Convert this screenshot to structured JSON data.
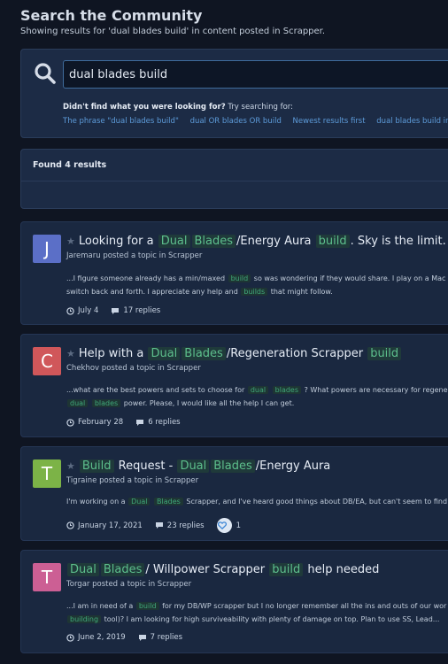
{
  "header": {
    "title": "Search the Community",
    "subtitle": "Showing results for 'dual blades build' in content posted in Scrapper."
  },
  "search": {
    "value": "dual blades build",
    "not_found_bold": "Didn't find what you were looking for?",
    "not_found_rest": " Try searching for:",
    "suggestions": [
      "The phrase \"dual blades build\"",
      "dual OR blades OR build",
      "Newest results first",
      "dual blades build in co"
    ]
  },
  "results_bar": {
    "count_label": "Found 4 results"
  },
  "results": [
    {
      "avatar_letter": "J",
      "avatar_color": "#5b6fc7",
      "title_pre": "Looking for a",
      "title_hl1": "Dual",
      "title_hl2": "Blades",
      "title_mid": "/Energy Aura",
      "title_hl3": "build",
      "title_post": ". Sky is the limit.",
      "meta": "Jaremaru posted a topic in Scrapper",
      "snippet_line1_a": "...I figure someone already has a min/maxed",
      "snippet_line1_hl": "build",
      "snippet_line1_b": "so was wondering if they would share. I play on a Mac",
      "snippet_line2_a": "switch back and forth. I appreciate any help and",
      "snippet_line2_hl": "builds",
      "snippet_line2_b": "that might follow.",
      "date": "July 4",
      "replies": "17 replies"
    },
    {
      "avatar_letter": "C",
      "avatar_color": "#d0575a",
      "title_pre": "Help with a",
      "title_hl1": "Dual",
      "title_hl2": "Blades",
      "title_mid": "/Regeneration Scrapper",
      "title_hl3": "build",
      "meta": "Chekhov posted a topic in Scrapper",
      "snippet_line1_a": "...what are the best powers and sets to choose for",
      "snippet_line1_hl": "dual",
      "snippet_line1_hl2": "blades",
      "snippet_line1_b": "? What powers are necessary for regener",
      "snippet_line2_hl": "dual",
      "snippet_line2_hl2": "blades",
      "snippet_line2_b": "power. Please, I would like all the help I can get.",
      "date": "February 28",
      "replies": "6 replies"
    },
    {
      "avatar_letter": "T",
      "avatar_color": "#7cb347",
      "title_hl1": "Build",
      "title_mid1": "Request -",
      "title_hl2": "Dual",
      "title_hl3": "Blades",
      "title_post": "/Energy Aura",
      "meta": "Tigraine posted a topic in Scrapper",
      "snippet_line1_a": "I'm working on a",
      "snippet_line1_hl": "Dual",
      "snippet_line1_hl2": "Blades",
      "snippet_line1_b": "Scrapper, and I've heard good things about DB/EA, but can't seem to find",
      "date": "January 17, 2021",
      "replies": "23 replies",
      "reactions": "1"
    },
    {
      "avatar_letter": "T",
      "avatar_color": "#cc5f94",
      "title_hl1": "Dual",
      "title_hl2": "Blades",
      "title_mid": "/ Willpower Scrapper",
      "title_hl3": "build",
      "title_post": "help needed",
      "meta": "Torgar posted a topic in Scrapper",
      "snippet_line1_a": "...I am in need of a",
      "snippet_line1_hl": "build",
      "snippet_line1_b": "for my DB/WP scrapper but I no longer remember all the ins and outs of our wor",
      "snippet_line2_hl": "building",
      "snippet_line2_b": "tool)? I am looking for high surviveability with plenty of damage on top. Plan to use SS, Lead...",
      "date": "June 2, 2019",
      "replies": "7 replies"
    }
  ]
}
